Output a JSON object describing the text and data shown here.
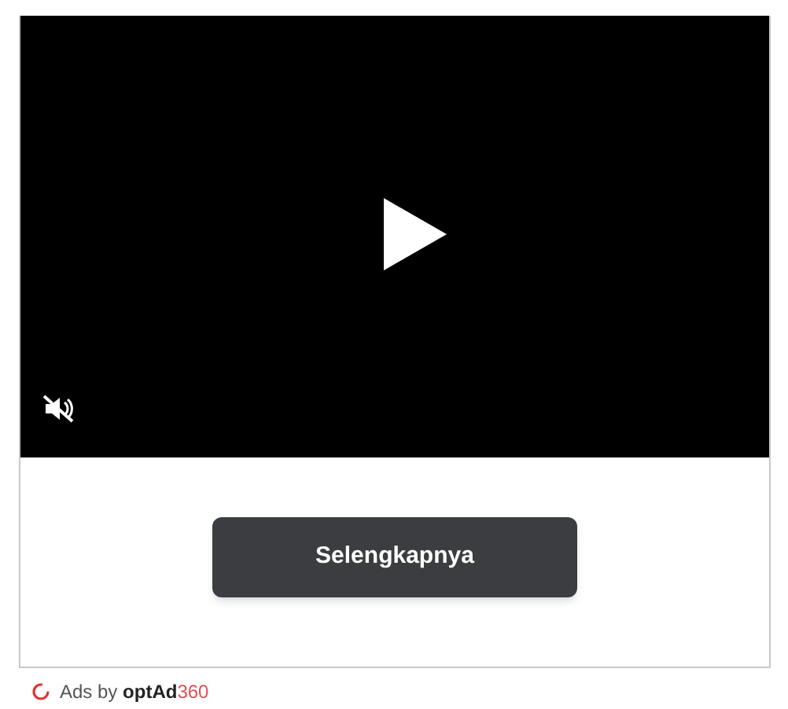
{
  "video": {
    "muted": true
  },
  "cta_button": {
    "label": "Selengkapnya"
  },
  "footer": {
    "attribution": "Ads by **optAd**",
    "attribution_accent": "360"
  }
}
